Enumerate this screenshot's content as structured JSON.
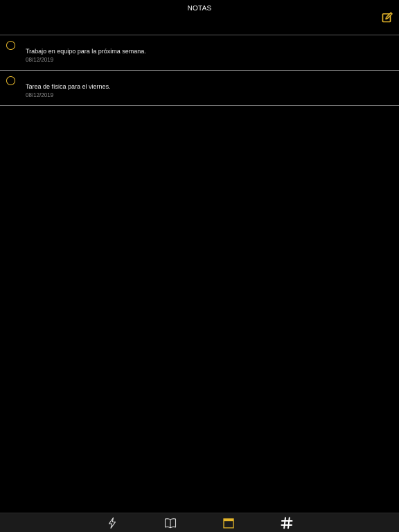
{
  "header": {
    "title": "NOTAS",
    "compose_icon": "compose-icon"
  },
  "notes": [
    {
      "text": "Trabajo en equipo para la próxima semana.",
      "date": "08/12/2019"
    },
    {
      "text": "Tarea de física para el viernes.",
      "date": "08/12/2019"
    }
  ],
  "tabbar": {
    "tabs": [
      {
        "icon": "lightning-icon",
        "selected": false
      },
      {
        "icon": "book-icon",
        "selected": false
      },
      {
        "icon": "calendar-icon",
        "selected": true
      },
      {
        "icon": "hashtag-icon",
        "selected": false
      }
    ]
  },
  "colors": {
    "accent": "#e5b62b",
    "background": "#000000",
    "tabbar": "#1b1b1b"
  }
}
